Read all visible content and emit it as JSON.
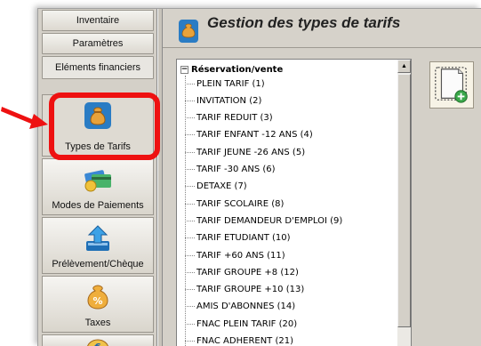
{
  "nav": {
    "inventaire": "Inventaire",
    "parametres": "Paramètres",
    "elements_financiers": "Eléments financiers",
    "types_tarifs": "Types de Tarifs",
    "modes_paiements": "Modes de Paiements",
    "prelevement": "Prélèvement/Chèque",
    "taxes": "Taxes"
  },
  "header": {
    "title": "Gestion des types de tarifs"
  },
  "tree": {
    "root": "Réservation/vente",
    "expander": "−",
    "items": [
      "PLEIN TARIF (1)",
      "INVITATION (2)",
      "TARIF REDUIT (3)",
      "TARIF ENFANT -12 ANS (4)",
      "TARIF JEUNE -26 ANS (5)",
      "TARIF -30 ANS (6)",
      "DETAXE (7)",
      "TARIF SCOLAIRE (8)",
      "TARIF DEMANDEUR D'EMPLOI (9)",
      "TARIF ETUDIANT (10)",
      "TARIF +60 ANS (11)",
      "TARIF GROUPE +8 (12)",
      "TARIF GROUPE +10 (13)",
      "AMIS D'ABONNES (14)",
      "FNAC PLEIN TARIF (20)",
      "FNAC ADHERENT (21)"
    ]
  },
  "icons": {
    "money_bag": "money-bag-icon",
    "cards": "credit-cards-icon",
    "upload": "upload-arrow-icon",
    "taxes": "percent-bag-icon",
    "new_document": "new-document-icon"
  },
  "colors": {
    "highlight": "#ee1111",
    "accent": "#1e78c8"
  }
}
